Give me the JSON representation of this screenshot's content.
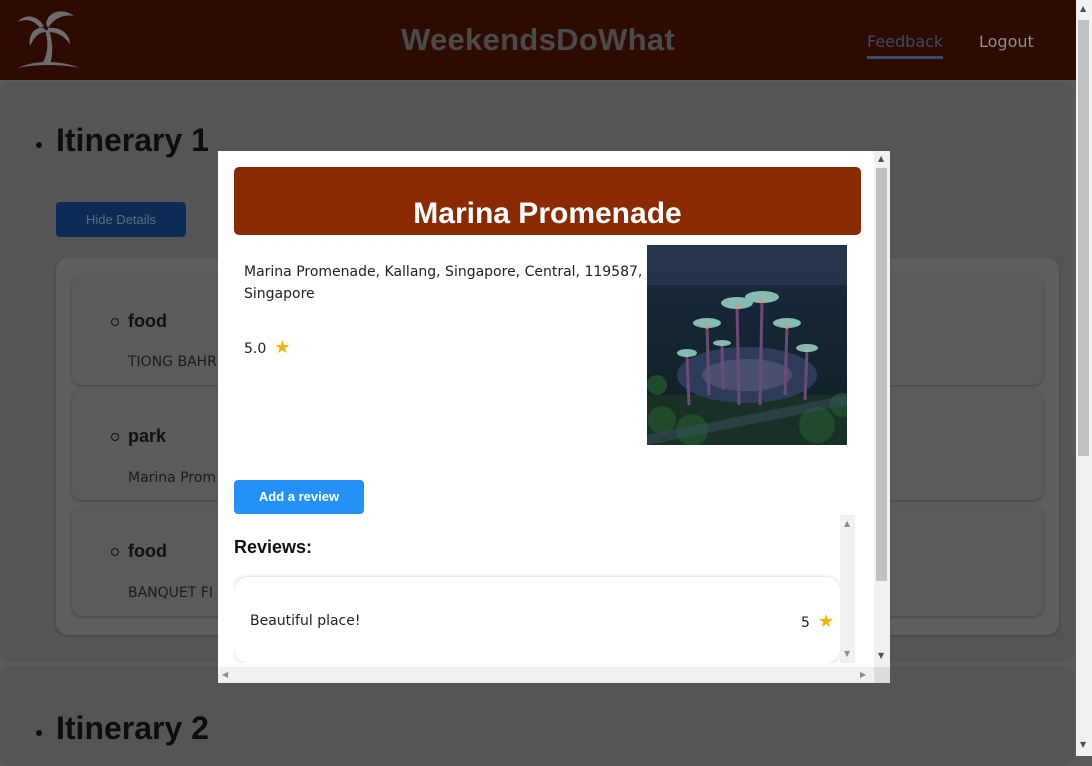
{
  "header": {
    "brand": "WeekendsDoWhat",
    "nav": {
      "feedback": "Feedback",
      "logout": "Logout"
    }
  },
  "itineraries": [
    {
      "title": "Itinerary 1",
      "toggle_label": "Hide Details",
      "stops": [
        {
          "type": "food",
          "name": "TIONG BAHR"
        },
        {
          "type": "park",
          "name": "Marina Prom"
        },
        {
          "type": "food",
          "name": "BANQUET FI"
        }
      ]
    },
    {
      "title": "Itinerary 2"
    }
  ],
  "modal": {
    "title": "Marina Promenade",
    "address": "Marina Promenade, Kallang, Singapore, Central, 119587, Singapore",
    "rating": "5.0",
    "add_review_label": "Add a review",
    "reviews_heading": "Reviews:",
    "reviews": [
      {
        "text": "Beautiful place!",
        "score": "5"
      }
    ]
  },
  "colors": {
    "header_bg": "#2e0b00",
    "modal_header_bg": "#8a2a00",
    "primary_button": "#2391f5",
    "star": "#f7b500"
  },
  "icons": {
    "logo": "palm-tree-logo-icon",
    "rating": "star-icon"
  }
}
